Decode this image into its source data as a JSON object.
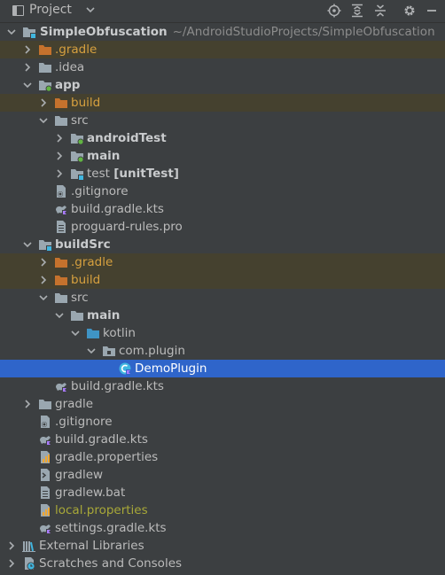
{
  "toolbar": {
    "title": "Project",
    "icons": [
      "locate-icon",
      "expand-all-icon",
      "collapse-all-icon",
      "settings-gear-icon",
      "hide-minus-icon"
    ]
  },
  "colors": {
    "background": "#3c3f41",
    "selection": "#2f65ca",
    "excluded_row": "#45412f",
    "excluded_text": "#d6a03f",
    "untracked_text": "#a8a838",
    "folder_grey": "#9aa7b0",
    "folder_orange": "#c5722d",
    "folder_blue": "#3f94c5"
  },
  "tree": {
    "root_label": "SimpleObfuscation",
    "root_path": "~/AndroidStudioProjects/SimpleObfuscation",
    "r_gradle": ".gradle",
    "r_idea": ".idea",
    "app": "app",
    "app_build": "build",
    "app_src": "src",
    "app_androidTest": "androidTest",
    "app_main": "main",
    "app_test": "test",
    "app_test_suffix": "[unitTest]",
    "app_gitignore": ".gitignore",
    "app_buildgradle": "build.gradle.kts",
    "app_proguard": "proguard-rules.pro",
    "buildSrc": "buildSrc",
    "bs_gradle": ".gradle",
    "bs_build": "build",
    "bs_src": "src",
    "bs_main": "main",
    "bs_kotlin": "kotlin",
    "bs_package": "com.plugin",
    "bs_demoplugin": "DemoPlugin",
    "bs_buildgradle": "build.gradle.kts",
    "r_gradle_dir": "gradle",
    "r_gitignore": ".gitignore",
    "r_buildgradle": "build.gradle.kts",
    "r_gradleprops": "gradle.properties",
    "r_gradlew": "gradlew",
    "r_gradlewbat": "gradlew.bat",
    "r_localprops": "local.properties",
    "r_settings": "settings.gradle.kts",
    "external_libraries": "External Libraries",
    "scratches": "Scratches and Consoles"
  }
}
